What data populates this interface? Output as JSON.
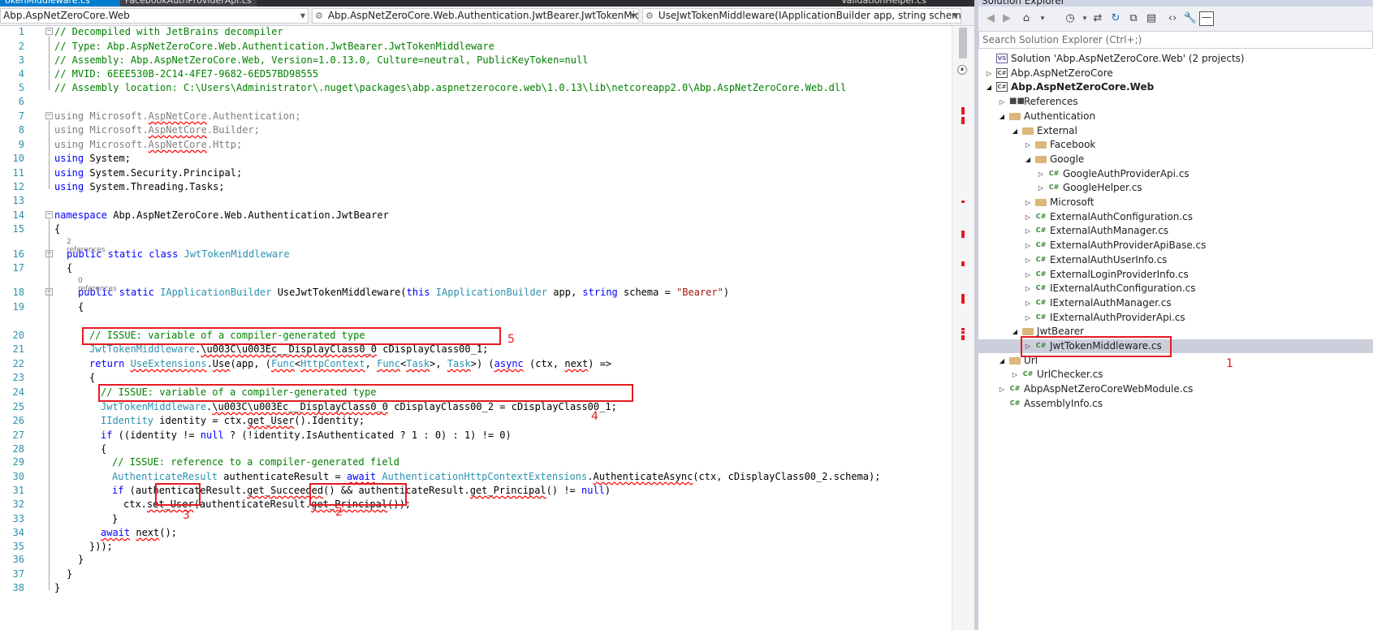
{
  "tabs": [
    {
      "label": "okenMiddleware.cs"
    },
    {
      "label": "FacebookAuthProviderApi.cs"
    },
    {
      "label": "ValidationHelper.cs"
    }
  ],
  "nav": {
    "project": "Abp.AspNetZeroCore.Web",
    "type": "Abp.AspNetZeroCore.Web.Authentication.JwtBearer.JwtTokenMiddlew",
    "member": "UseJwtTokenMiddleware(IApplicationBuilder app, string schema = \"E"
  },
  "code": {
    "line_numbers": [
      "1",
      "2",
      "3",
      "4",
      "5",
      "6",
      "7",
      "8",
      "9",
      "10",
      "11",
      "12",
      "13",
      "14",
      "15",
      "16",
      "17",
      "18",
      "19",
      "20",
      "21",
      "22",
      "23",
      "24",
      "25",
      "26",
      "27",
      "28",
      "29",
      "30",
      "31",
      "32",
      "33",
      "34",
      "35",
      "36",
      "37",
      "38"
    ],
    "lines": [
      "// Decompiled with JetBrains decompiler",
      "// Type: Abp.AspNetZeroCore.Web.Authentication.JwtBearer.JwtTokenMiddleware",
      "// Assembly: Abp.AspNetZeroCore.Web, Version=1.0.13.0, Culture=neutral, PublicKeyToken=null",
      "// MVID: 6EEE530B-2C14-4FE7-9682-6ED57BD98555",
      "// Assembly location: C:\\Users\\Administrator\\.nuget\\packages\\abp.aspnetzerocore.web\\1.0.13\\lib\\netcoreapp2.0\\Abp.AspNetZeroCore.Web.dll",
      "",
      "using Microsoft.AspNetCore.Authentication;",
      "using Microsoft.AspNetCore.Builder;",
      "using Microsoft.AspNetCore.Http;",
      "using System;",
      "using System.Security.Principal;",
      "using System.Threading.Tasks;",
      "",
      "namespace Abp.AspNetZeroCore.Web.Authentication.JwtBearer",
      "{",
      "public static class JwtTokenMiddleware",
      "{",
      "public static IApplicationBuilder UseJwtTokenMiddleware(this IApplicationBuilder app, string schema = \"Bearer\")",
      "{",
      "// ISSUE: variable of a compiler-generated type",
      "JwtTokenMiddleware.\\u003C\\u003Ec__DisplayClass0_0 cDisplayClass00_1;",
      "return UseExtensions.Use(app, (Func<HttpContext, Func<Task>, Task>) (async (ctx, next) =>",
      "{",
      "// ISSUE: variable of a compiler-generated type",
      "JwtTokenMiddleware.\\u003C\\u003Ec__DisplayClass0_0 cDisplayClass00_2 = cDisplayClass00_1;",
      "IIdentity identity = ctx.get_User().Identity;",
      "if ((identity != null ? (!identity.IsAuthenticated ? 1 : 0) : 1) != 0)",
      "{",
      "// ISSUE: reference to a compiler-generated field",
      "AuthenticateResult authenticateResult = await AuthenticationHttpContextExtensions.AuthenticateAsync(ctx, cDisplayClass00_2.schema);",
      "if (authenticateResult.get_Succeeded() && authenticateResult.get_Principal() != null)",
      "ctx.set_User(authenticateResult.get_Principal());",
      "}",
      "await next();",
      "}));",
      "}",
      "}",
      "}"
    ],
    "references": [
      "2 references",
      "0 references"
    ]
  },
  "annotations": [
    "1",
    "2",
    "3",
    "4",
    "5"
  ],
  "solution_explorer": {
    "title": "Solution Explorer",
    "search_placeholder": "Search Solution Explorer (Ctrl+;)",
    "toolbar_icons": [
      "back-icon",
      "forward-icon",
      "home-icon",
      "sync-icon",
      "history-icon",
      "refresh-icon",
      "collapse-all-icon",
      "show-all-files-icon",
      "code-icon",
      "properties-icon",
      "preview-icon"
    ],
    "items": [
      {
        "label": "Solution 'Abp.AspNetZeroCore.Web' (2 projects)",
        "icon": "solution-icon",
        "level": 0,
        "expander": "none"
      },
      {
        "label": "Abp.AspNetZeroCore",
        "icon": "csproj-icon",
        "level": 0,
        "expander": "collapsed"
      },
      {
        "label": "Abp.AspNetZeroCore.Web",
        "icon": "csproj-icon",
        "level": 0,
        "expander": "expanded",
        "bold": true
      },
      {
        "label": "References",
        "icon": "references-icon",
        "level": 1,
        "expander": "collapsed"
      },
      {
        "label": "Authentication",
        "icon": "folder-icon",
        "level": 1,
        "expander": "expanded"
      },
      {
        "label": "External",
        "icon": "folder-icon",
        "level": 2,
        "expander": "expanded"
      },
      {
        "label": "Facebook",
        "icon": "folder-icon",
        "level": 3,
        "expander": "collapsed"
      },
      {
        "label": "Google",
        "icon": "folder-icon",
        "level": 3,
        "expander": "expanded"
      },
      {
        "label": "GoogleAuthProviderApi.cs",
        "icon": "csharp-file-icon",
        "level": 4,
        "expander": "collapsed"
      },
      {
        "label": "GoogleHelper.cs",
        "icon": "csharp-file-icon",
        "level": 4,
        "expander": "collapsed"
      },
      {
        "label": "Microsoft",
        "icon": "folder-icon",
        "level": 3,
        "expander": "collapsed"
      },
      {
        "label": "ExternalAuthConfiguration.cs",
        "icon": "csharp-file-icon",
        "level": 3,
        "expander": "collapsed"
      },
      {
        "label": "ExternalAuthManager.cs",
        "icon": "csharp-file-icon",
        "level": 3,
        "expander": "collapsed"
      },
      {
        "label": "ExternalAuthProviderApiBase.cs",
        "icon": "csharp-file-icon",
        "level": 3,
        "expander": "collapsed"
      },
      {
        "label": "ExternalAuthUserInfo.cs",
        "icon": "csharp-file-icon",
        "level": 3,
        "expander": "collapsed"
      },
      {
        "label": "ExternalLoginProviderInfo.cs",
        "icon": "csharp-file-icon",
        "level": 3,
        "expander": "collapsed"
      },
      {
        "label": "IExternalAuthConfiguration.cs",
        "icon": "csharp-file-icon",
        "level": 3,
        "expander": "collapsed"
      },
      {
        "label": "IExternalAuthManager.cs",
        "icon": "csharp-file-icon",
        "level": 3,
        "expander": "collapsed"
      },
      {
        "label": "IExternalAuthProviderApi.cs",
        "icon": "csharp-file-icon",
        "level": 3,
        "expander": "collapsed"
      },
      {
        "label": "JwtBearer",
        "icon": "folder-icon",
        "level": 2,
        "expander": "expanded"
      },
      {
        "label": "JwtTokenMiddleware.cs",
        "icon": "csharp-file-icon",
        "level": 3,
        "expander": "collapsed",
        "selected": true
      },
      {
        "label": "Url",
        "icon": "folder-icon",
        "level": 1,
        "expander": "expanded"
      },
      {
        "label": "UrlChecker.cs",
        "icon": "csharp-file-icon",
        "level": 2,
        "expander": "collapsed"
      },
      {
        "label": "AbpAspNetZeroCoreWebModule.cs",
        "icon": "csharp-file-icon",
        "level": 1,
        "expander": "collapsed"
      },
      {
        "label": "AssemblyInfo.cs",
        "icon": "csharp-file-icon",
        "level": 1,
        "expander": "none"
      }
    ]
  },
  "colors": {
    "accent": "#007acc",
    "keyword": "#0000ff",
    "comment": "#008000",
    "type": "#2b91af",
    "string": "#a31515",
    "annotation": "#e51b23"
  }
}
